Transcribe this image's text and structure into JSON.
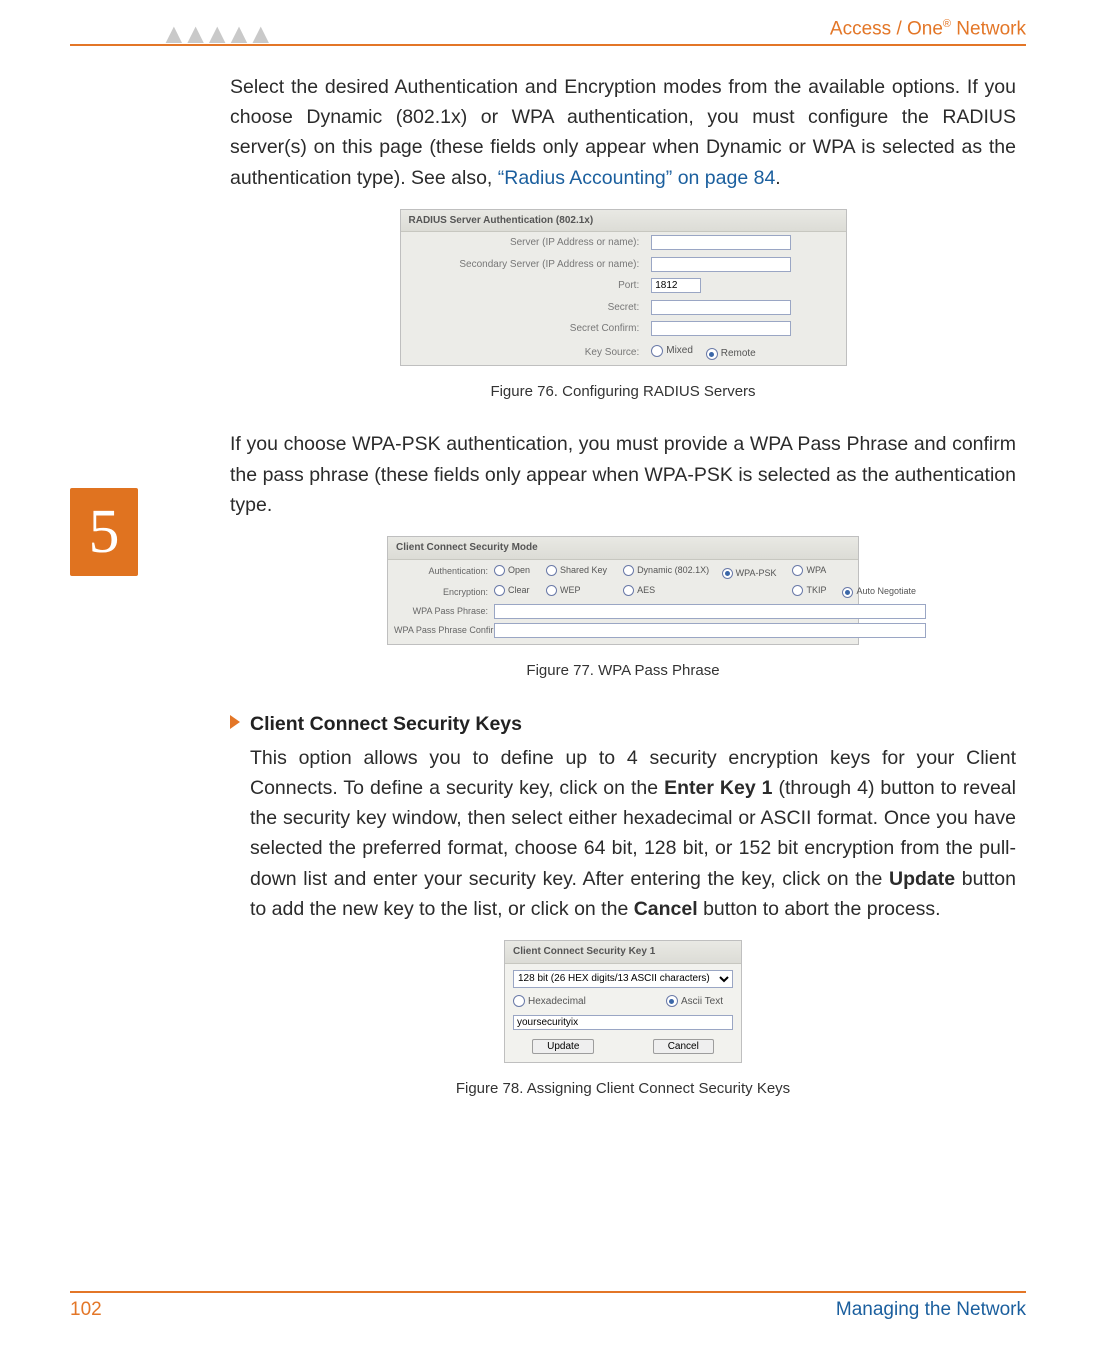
{
  "header": {
    "brand": "Access / One",
    "brand_sup": "®",
    "brand_tail": " Network",
    "logo_glyph": "▲▲▲▲▲"
  },
  "footer": {
    "page_number": "102",
    "section": "Managing the Network"
  },
  "chapter": "5",
  "para1_a": "Select the desired Authentication and Encryption modes from the available options. If you choose Dynamic (802.1x) or WPA authentication, you must configure the RADIUS server(s) on this page (these fields only appear when Dynamic or WPA is selected as the authentication type). See also, ",
  "para1_link": "“Radius Accounting” on page 84",
  "para1_tail": ".",
  "fig76_caption": "Figure 76. Configuring RADIUS Servers",
  "para2": "If you choose WPA-PSK authentication, you must provide a WPA Pass Phrase and confirm the pass phrase (these fields only appear when WPA-PSK is selected as the authentication type.",
  "fig77_caption": "Figure 77. WPA Pass Phrase",
  "bullet_title": "Client Connect Security Keys",
  "para3_a": "This option allows you to define up to 4 security encryption keys for your Client Connects. To define a security key, click on the ",
  "para3_b_bold": "Enter Key 1",
  "para3_c": " (through 4) button to reveal the security key window, then select either hexadecimal or ASCII format. Once you have selected the preferred format, choose 64 bit, 128 bit, or 152 bit encryption from the pull-down list and enter your security key. After entering the key, click on the ",
  "para3_d_bold": "Update",
  "para3_e": " button to add the new key to the list, or click on the ",
  "para3_f_bold": "Cancel",
  "para3_g": " button to abort the process.",
  "fig78_caption": "Figure 78. Assigning Client Connect Security Keys",
  "ss1": {
    "title": "RADIUS Server Authentication (802.1x)",
    "labels": {
      "server": "Server (IP Address or name):",
      "sec_server": "Secondary Server (IP Address or name):",
      "port": "Port:",
      "secret": "Secret:",
      "secret_confirm": "Secret Confirm:",
      "key_source": "Key Source:"
    },
    "values": {
      "port": "1812"
    },
    "key_source_options": {
      "mixed": "Mixed",
      "remote": "Remote"
    }
  },
  "ss2": {
    "title": "Client Connect Security Mode",
    "rows": {
      "auth": "Authentication:",
      "enc": "Encryption:",
      "pass": "WPA Pass Phrase:",
      "pass_confirm": "WPA Pass Phrase Confirm:"
    },
    "auth_opts": {
      "open": "Open",
      "shared": "Shared Key",
      "dyn": "Dynamic (802.1X)",
      "wpapsk": "WPA-PSK",
      "wpa": "WPA"
    },
    "enc_opts": {
      "clear": "Clear",
      "wep": "WEP",
      "aes": "AES",
      "tkip": "TKIP",
      "auto": "Auto Negotiate"
    }
  },
  "ss3": {
    "title": "Client Connect Security Key 1",
    "dropdown": "128 bit (26 HEX digits/13 ASCII characters)",
    "hex": "Hexadecimal",
    "ascii": "Ascii Text",
    "value": "yoursecurityix",
    "update": "Update",
    "cancel": "Cancel"
  }
}
